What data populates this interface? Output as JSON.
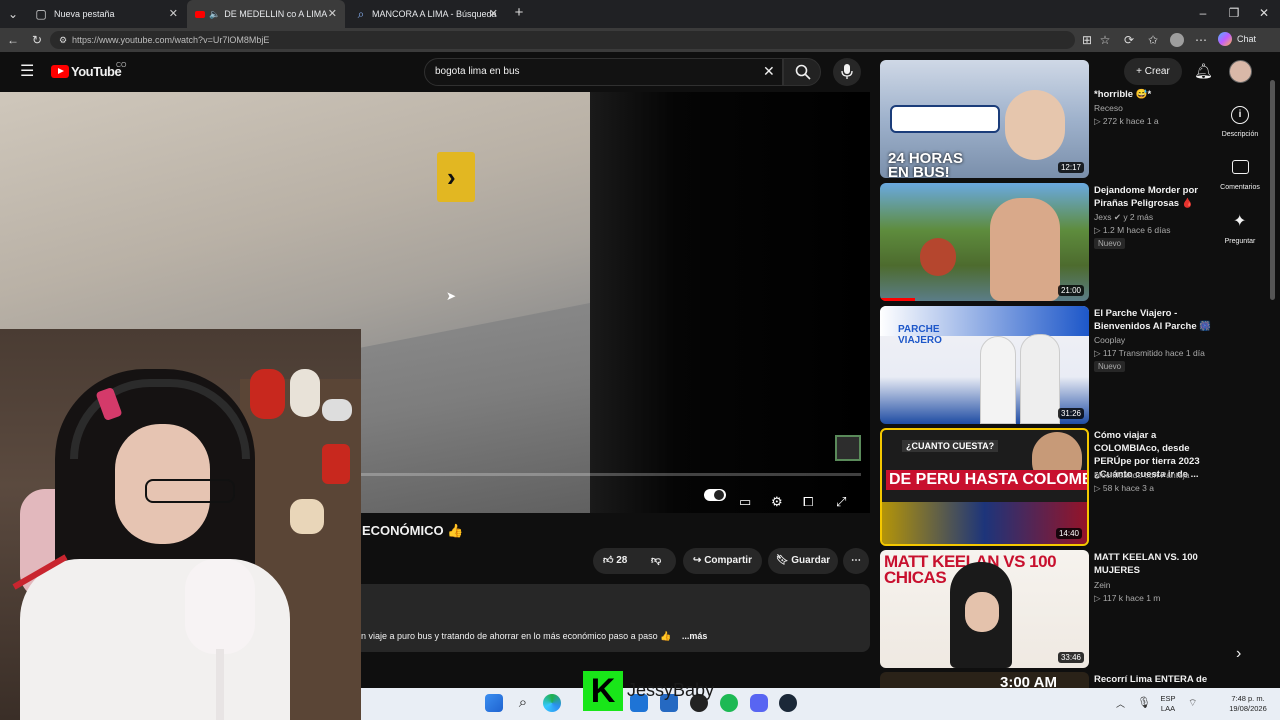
{
  "browser": {
    "tabs": [
      {
        "label": "Nueva pestaña"
      },
      {
        "label": "DE MEDELLIN co A LIMA pe EN"
      },
      {
        "label": "MANCORA A LIMA - Búsqueda"
      }
    ],
    "url": "https://www.youtube.com/watch?v=Ur7lOM8MbjE",
    "chat_label": "Chat"
  },
  "youtube": {
    "logo": "YouTube",
    "region": "CO",
    "search_value": "bogota lima en bus",
    "create_label": "Crear"
  },
  "video": {
    "title": "ECONÓMICO 👍",
    "likes": "28",
    "share_label": "Compartir",
    "save_label": "Guardar",
    "description": "n viaje a puro bus y tratando de ahorrar en lo más económico paso a paso 👍",
    "more_label": "...más"
  },
  "side_rail": {
    "description": "Descripción",
    "comments": "Comentarios",
    "ask": "Preguntar"
  },
  "recommendations": [
    {
      "title": "*horrible 😅*",
      "channel": "Receso",
      "meta": "▷ 272 k   hace 1 a",
      "duration": "12:17",
      "thumb_text": "24 HORAS EN BUS!"
    },
    {
      "title": "Dejandome Morder por Pirañas Peligrosas 🩸",
      "channel": "Jexs ✔ y 2 más",
      "meta": "▷ 1.2 M   hace 6 días",
      "badge": "Nuevo",
      "duration": "21:00"
    },
    {
      "title": "El Parche Viajero - Bienvenidos Al Parche 🎆",
      "channel": "Cooplay",
      "meta": "▷ 117   Transmitido hace 1 día",
      "badge": "Nuevo",
      "duration": "31:26",
      "thumb_text": "PARCHE VIAJERO"
    },
    {
      "title": "Cómo viajar a COLOMBIAco, desde PERÚpe por tierra 2023 ¿Cuánto cuesta ir de ...",
      "channel": "Mochileando con Pantoja",
      "meta": "▷ 58 k   hace 3 a",
      "duration": "14:40",
      "thumb_text": "DE PERU HASTA COLOMBIA",
      "thumb_small": "¿CUANTO CUESTA?"
    },
    {
      "title": "MATT KEELAN VS. 100 MUJERES",
      "channel": "Zein",
      "meta": "▷ 117 k   hace 1 m",
      "duration": "33:46",
      "thumb_text": "MATT KEELAN VS 100 CHICAS"
    },
    {
      "title": "Recorrí Lima ENTERA de",
      "thumb_text": "3:00 AM"
    }
  ],
  "overlay": {
    "letter": "K",
    "name": "JessyBaby"
  },
  "taskbar": {
    "lang": "ESP",
    "layout": "LAA",
    "time": "7:48 p. m.",
    "date": "19/08/2026"
  },
  "colors": {
    "youtube_red": "#ff0000",
    "accent_green": "#19e619",
    "sign_yellow": "#e2b722"
  }
}
